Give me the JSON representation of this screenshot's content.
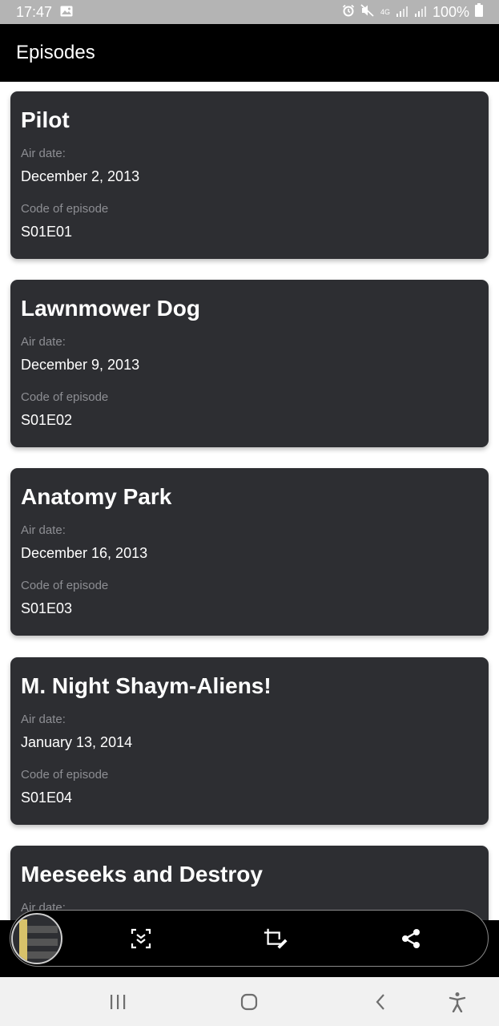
{
  "status_bar": {
    "time": "17:47",
    "battery_text": "100%",
    "network_text": "4G",
    "icons": [
      "gallery-icon",
      "alarm-icon",
      "mute-icon",
      "signal-icon",
      "signal-icon",
      "battery-icon"
    ]
  },
  "app_bar": {
    "title": "Episodes"
  },
  "episodes": [
    {
      "name": "Pilot",
      "air_date_label": "Air date:",
      "air_date": "December 2, 2013",
      "code_label": "Code of episode",
      "code": "S01E01"
    },
    {
      "name": "Lawnmower Dog",
      "air_date_label": "Air date:",
      "air_date": "December 9, 2013",
      "code_label": "Code of episode",
      "code": "S01E02"
    },
    {
      "name": "Anatomy Park",
      "air_date_label": "Air date:",
      "air_date": "December 16, 2013",
      "code_label": "Code of episode",
      "code": "S01E03"
    },
    {
      "name": "M. Night Shaym-Aliens!",
      "air_date_label": "Air date:",
      "air_date": "January 13, 2014",
      "code_label": "Code of episode",
      "code": "S01E04"
    },
    {
      "name": "Meeseeks and Destroy",
      "air_date_label": "Air date:",
      "air_date": "",
      "code_label": "",
      "code": ""
    }
  ],
  "screenshot_toolbar": {
    "buttons": [
      "scroll-capture-icon",
      "crop-edit-icon",
      "share-icon"
    ]
  },
  "nav_bar": {
    "buttons": [
      "recents-icon",
      "home-icon",
      "back-icon",
      "accessibility-icon"
    ]
  },
  "colors": {
    "card_background": "#2d2e32",
    "app_bar_background": "#000000",
    "status_bar_background": "#b4b4b4",
    "label_color": "#8d8e93"
  }
}
